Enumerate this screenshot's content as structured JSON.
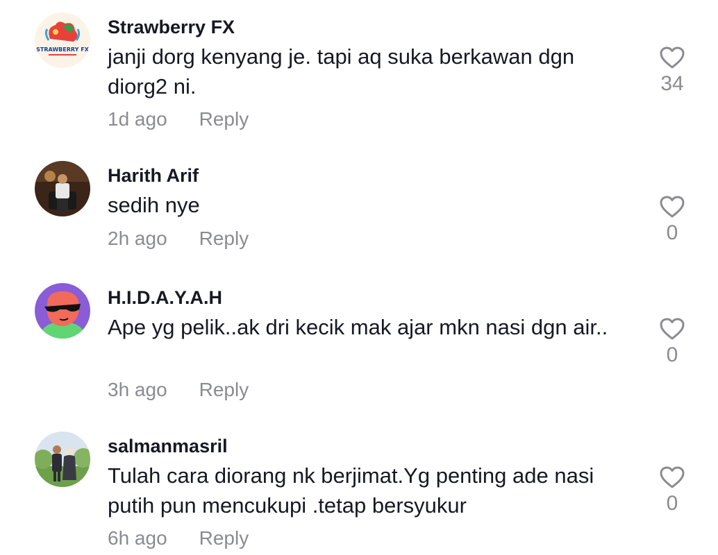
{
  "comments": [
    {
      "username": "Strawberry FX",
      "avatar_text": "STRAWBERRY FX",
      "text": "janji dorg kenyang je. tapi aq suka berkawan dgn diorg2 ni.",
      "time": "1d ago",
      "reply_label": "Reply",
      "likes": "34"
    },
    {
      "username": "Harith Arif",
      "text": "sedih nye",
      "time": "2h ago",
      "reply_label": "Reply",
      "likes": "0"
    },
    {
      "username": "H.I.D.A.Y.A.H",
      "text": "Ape yg pelik..ak dri kecik mak ajar mkn nasi dgn air..",
      "time": "3h ago",
      "reply_label": "Reply",
      "likes": "0"
    },
    {
      "username": "salmanmasril",
      "text": "Tulah cara diorang nk berjimat.Yg penting ade nasi putih pun mencukupi .tetap bersyukur",
      "time": "6h ago",
      "reply_label": "Reply",
      "likes": "0"
    }
  ],
  "icons": {
    "like": "heart-outline-icon"
  },
  "colors": {
    "text": "#161823",
    "muted": "#8a8b91"
  }
}
